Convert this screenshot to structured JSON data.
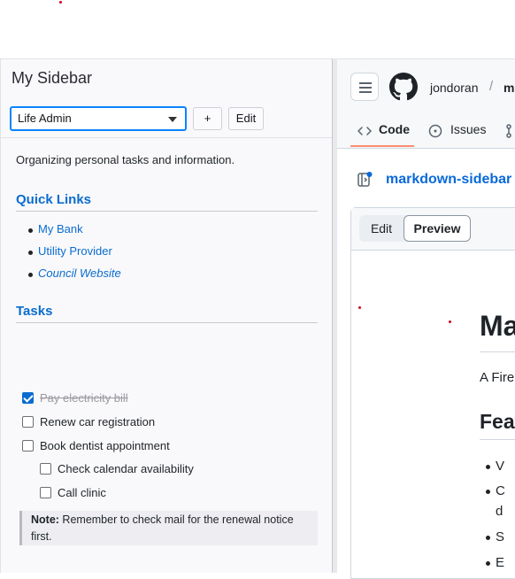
{
  "sidebar": {
    "title": "My Sidebar",
    "selected_sidebar": "Life Admin",
    "add_button": "+",
    "edit_button": "Edit",
    "description": "Organizing personal tasks and information.",
    "quick_links_heading": "Quick Links",
    "quick_links": [
      "My Bank",
      "Utility Provider",
      "Council Website"
    ],
    "tasks_heading": "Tasks",
    "tasks": [
      {
        "label": "Pay electricity bill",
        "checked": true
      },
      {
        "label": "Renew car registration",
        "checked": false
      },
      {
        "label": "Book dentist appointment",
        "checked": false
      },
      {
        "label": "Check calendar availability",
        "checked": false
      },
      {
        "label": "Call clinic",
        "checked": false
      }
    ],
    "note_label": "Note:",
    "note_text": " Remember to check mail for the renewal notice first."
  },
  "github": {
    "username": "jondoran",
    "separator": "/",
    "repo_initial": "m",
    "tabs": [
      "Code",
      "Issues"
    ],
    "repo_name": "markdown-sidebar",
    "repo_separator": "/",
    "editor_tabs": {
      "edit": "Edit",
      "preview": "Preview"
    },
    "preview": {
      "h1": "Ma",
      "paragraph": "A Fire",
      "h2": "Feat",
      "list": [
        "V",
        "C",
        "d",
        "S",
        "E"
      ]
    }
  },
  "colors": {
    "link": "#0a6ccf",
    "accent_focus": "#0a84ff",
    "github_link": "#0969da",
    "tab_underline": "#fd8c73"
  }
}
